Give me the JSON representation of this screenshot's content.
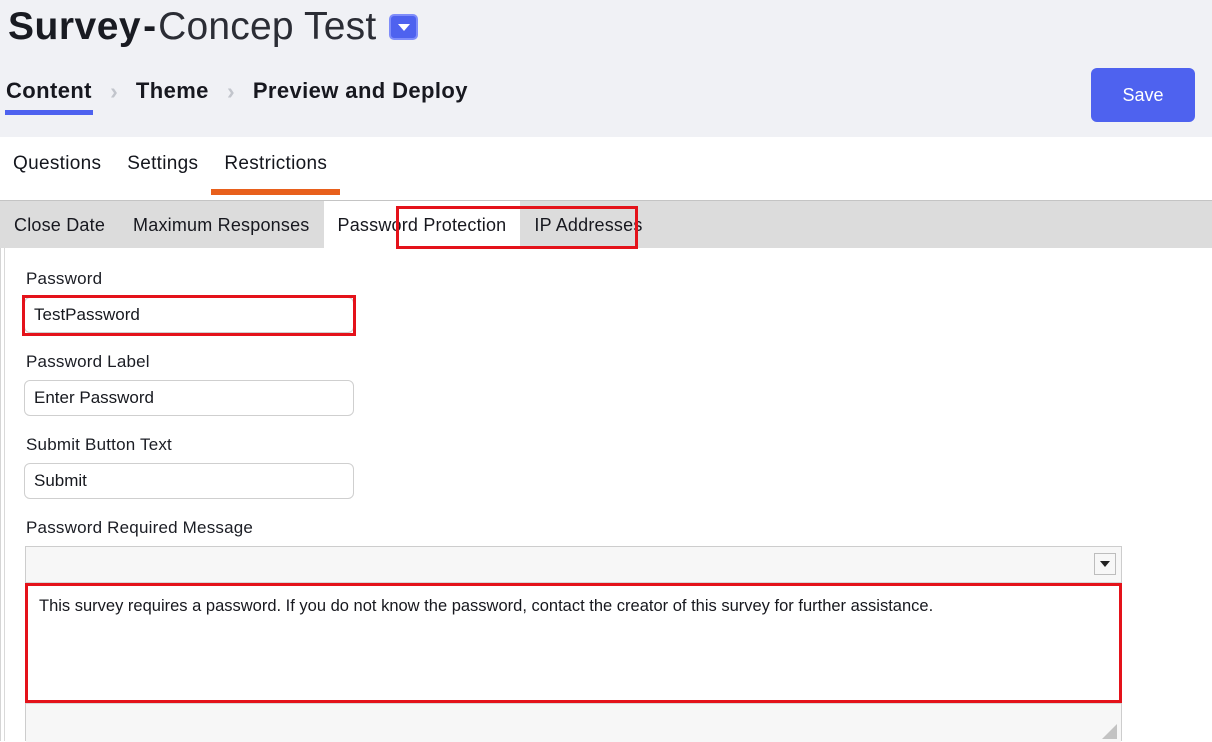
{
  "header": {
    "title_strong": "Survey",
    "title_separator": "-",
    "title_light": "Concep Test",
    "title_dropdown_icon": "chevron-down-icon",
    "save_label": "Save",
    "accent_blue": "#4e62ef",
    "accent_orange": "#e8601c",
    "annotation_red": "#e4121a"
  },
  "breadcrumb": {
    "separator": "›",
    "items": [
      {
        "label": "Content",
        "active": true
      },
      {
        "label": "Theme",
        "active": false
      },
      {
        "label": "Preview and Deploy",
        "active": false
      }
    ]
  },
  "tabs": [
    {
      "label": "Questions",
      "active": false
    },
    {
      "label": "Settings",
      "active": false
    },
    {
      "label": "Restrictions",
      "active": true
    }
  ],
  "subtabs": [
    {
      "label": "Close Date",
      "active": false
    },
    {
      "label": "Maximum Responses",
      "active": false
    },
    {
      "label": "Password Protection",
      "active": true
    },
    {
      "label": "IP Addresses",
      "active": false
    }
  ],
  "form": {
    "password": {
      "label": "Password",
      "value": "TestPassword",
      "placeholder": ""
    },
    "password_label": {
      "label": "Password Label",
      "value": "Enter Password",
      "placeholder": ""
    },
    "submit_button_text": {
      "label": "Submit Button Text",
      "value": "Submit",
      "placeholder": ""
    },
    "password_required_message": {
      "label": "Password Required Message",
      "value": "This survey requires a password. If you do not know the password, contact the creator of this survey for further assistance.",
      "toolbar_overflow_icon": "chevron-down-icon",
      "resize_grip_icon": "resize-grip-icon"
    }
  }
}
